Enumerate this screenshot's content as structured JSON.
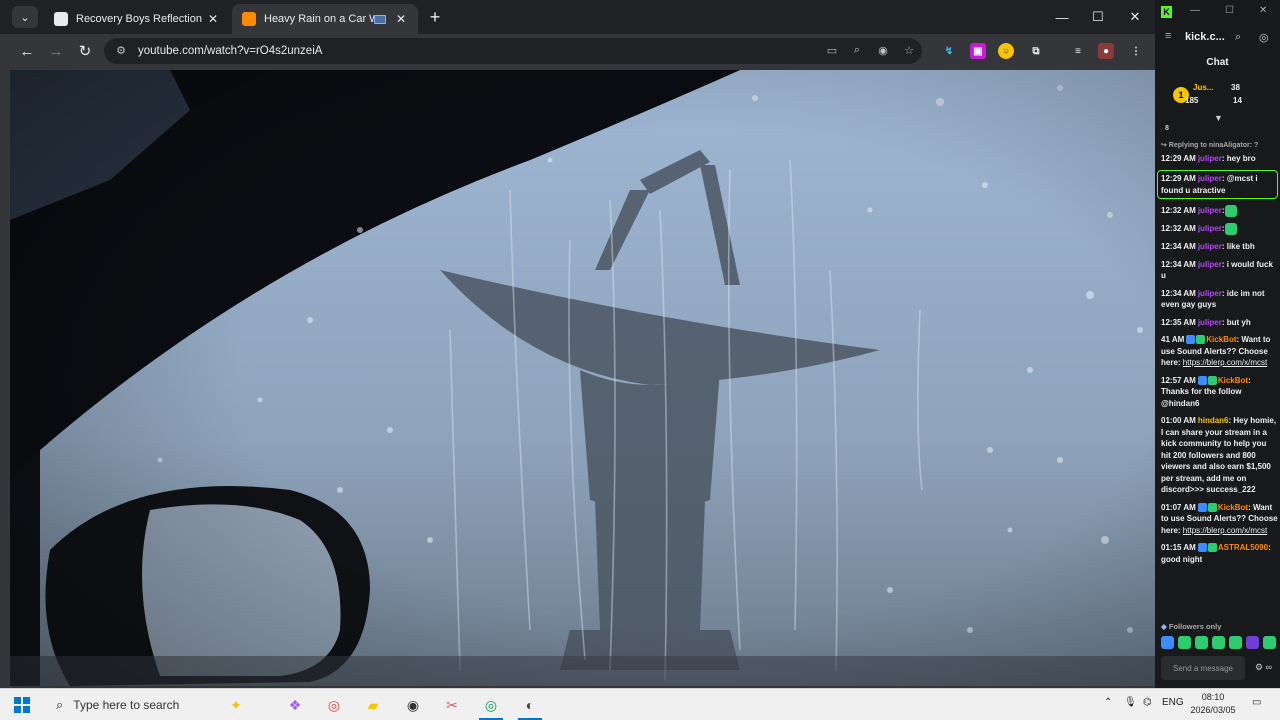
{
  "browser": {
    "tabs": [
      {
        "title": "Recovery Boys Reflection",
        "state": "inactive",
        "favicon_color": "#e8eaed"
      },
      {
        "title": "Heavy Rain on a Car Windsh",
        "state": "active",
        "favicon_color": "#ff8a00"
      }
    ],
    "url": "youtube.com/watch?v=rO4s2unzeiA",
    "accent": "#8ab4f8"
  },
  "video": {
    "subject": "rain-on-windshield-satellite-dish-scene"
  },
  "kick": {
    "site": "kick.c...",
    "chat_title": "Chat",
    "pinned": {
      "name": "Jus...",
      "stat1": "38",
      "stat2": "185",
      "stat3": "14",
      "coin": "1"
    },
    "count_marker": "8",
    "reply_line": "↪ Replying to ninaAligator: ?",
    "messages": [
      {
        "ts": "12:29 AM",
        "user": "juliper",
        "user_color": "#b04cf0",
        "text": ": hey bro",
        "highlight": false
      },
      {
        "ts": "12:29 AM",
        "user": "juliper",
        "user_color": "#b04cf0",
        "text": ": @mcst i found u atractive",
        "highlight": true
      },
      {
        "ts": "12:32 AM",
        "user": "juliper",
        "user_color": "#b04cf0",
        "text": ":",
        "emote": true,
        "highlight": false
      },
      {
        "ts": "12:32 AM",
        "user": "juliper",
        "user_color": "#b04cf0",
        "text": ":",
        "emote": true,
        "highlight": false
      },
      {
        "ts": "12:34 AM",
        "user": "juliper",
        "user_color": "#b04cf0",
        "text": ": like tbh",
        "highlight": false
      },
      {
        "ts": "12:34 AM",
        "user": "juliper",
        "user_color": "#b04cf0",
        "text": ": i would fuck u",
        "highlight": false
      },
      {
        "ts": "12:34 AM",
        "user": "juliper",
        "user_color": "#b04cf0",
        "text": ": idc im not even gay guys",
        "highlight": false
      },
      {
        "ts": "12:35 AM",
        "user": "juliper",
        "user_color": "#b04cf0",
        "text": ": but yh",
        "highlight": false
      },
      {
        "ts": "41 AM",
        "user": "KickBot",
        "user_color": "#ff8a00",
        "text": ": Want to use Sound Alerts?? Choose here: ",
        "link": "https://blerp.com/x/mcst",
        "badges": true,
        "highlight": false
      },
      {
        "ts": "12:57 AM",
        "user": "KickBot",
        "user_color": "#ff8a00",
        "text": ": Thanks for the follow @hindan6",
        "badges": true,
        "highlight": false
      },
      {
        "ts": "01:00 AM",
        "user": "hindan6",
        "user_color": "#f6c400",
        "text": ": Hey homie, I can share your stream in a kick community to help you hit 200 followers and 800 viewers and also earn $1,500 per stream, add me on discord>>> success_222",
        "highlight": false
      },
      {
        "ts": "01:07 AM",
        "user": "KickBot",
        "user_color": "#ff8a00",
        "text": ": Want to use Sound Alerts?? Choose here: ",
        "link": "https://blerp.com/x/mcst",
        "badges": true,
        "highlight": false
      },
      {
        "ts": "01:15 AM",
        "user": "ASTRAL5090",
        "user_color": "#ff8a00",
        "text": ": good night",
        "badges": true,
        "highlight": false
      }
    ],
    "followers_only": "Followers only",
    "send_placeholder": "Send a message",
    "brand_color": "#53fc18"
  },
  "taskbar": {
    "search_placeholder": "Type here to search",
    "language": "ENG",
    "time": "08:10",
    "date": "2026/03/05"
  }
}
